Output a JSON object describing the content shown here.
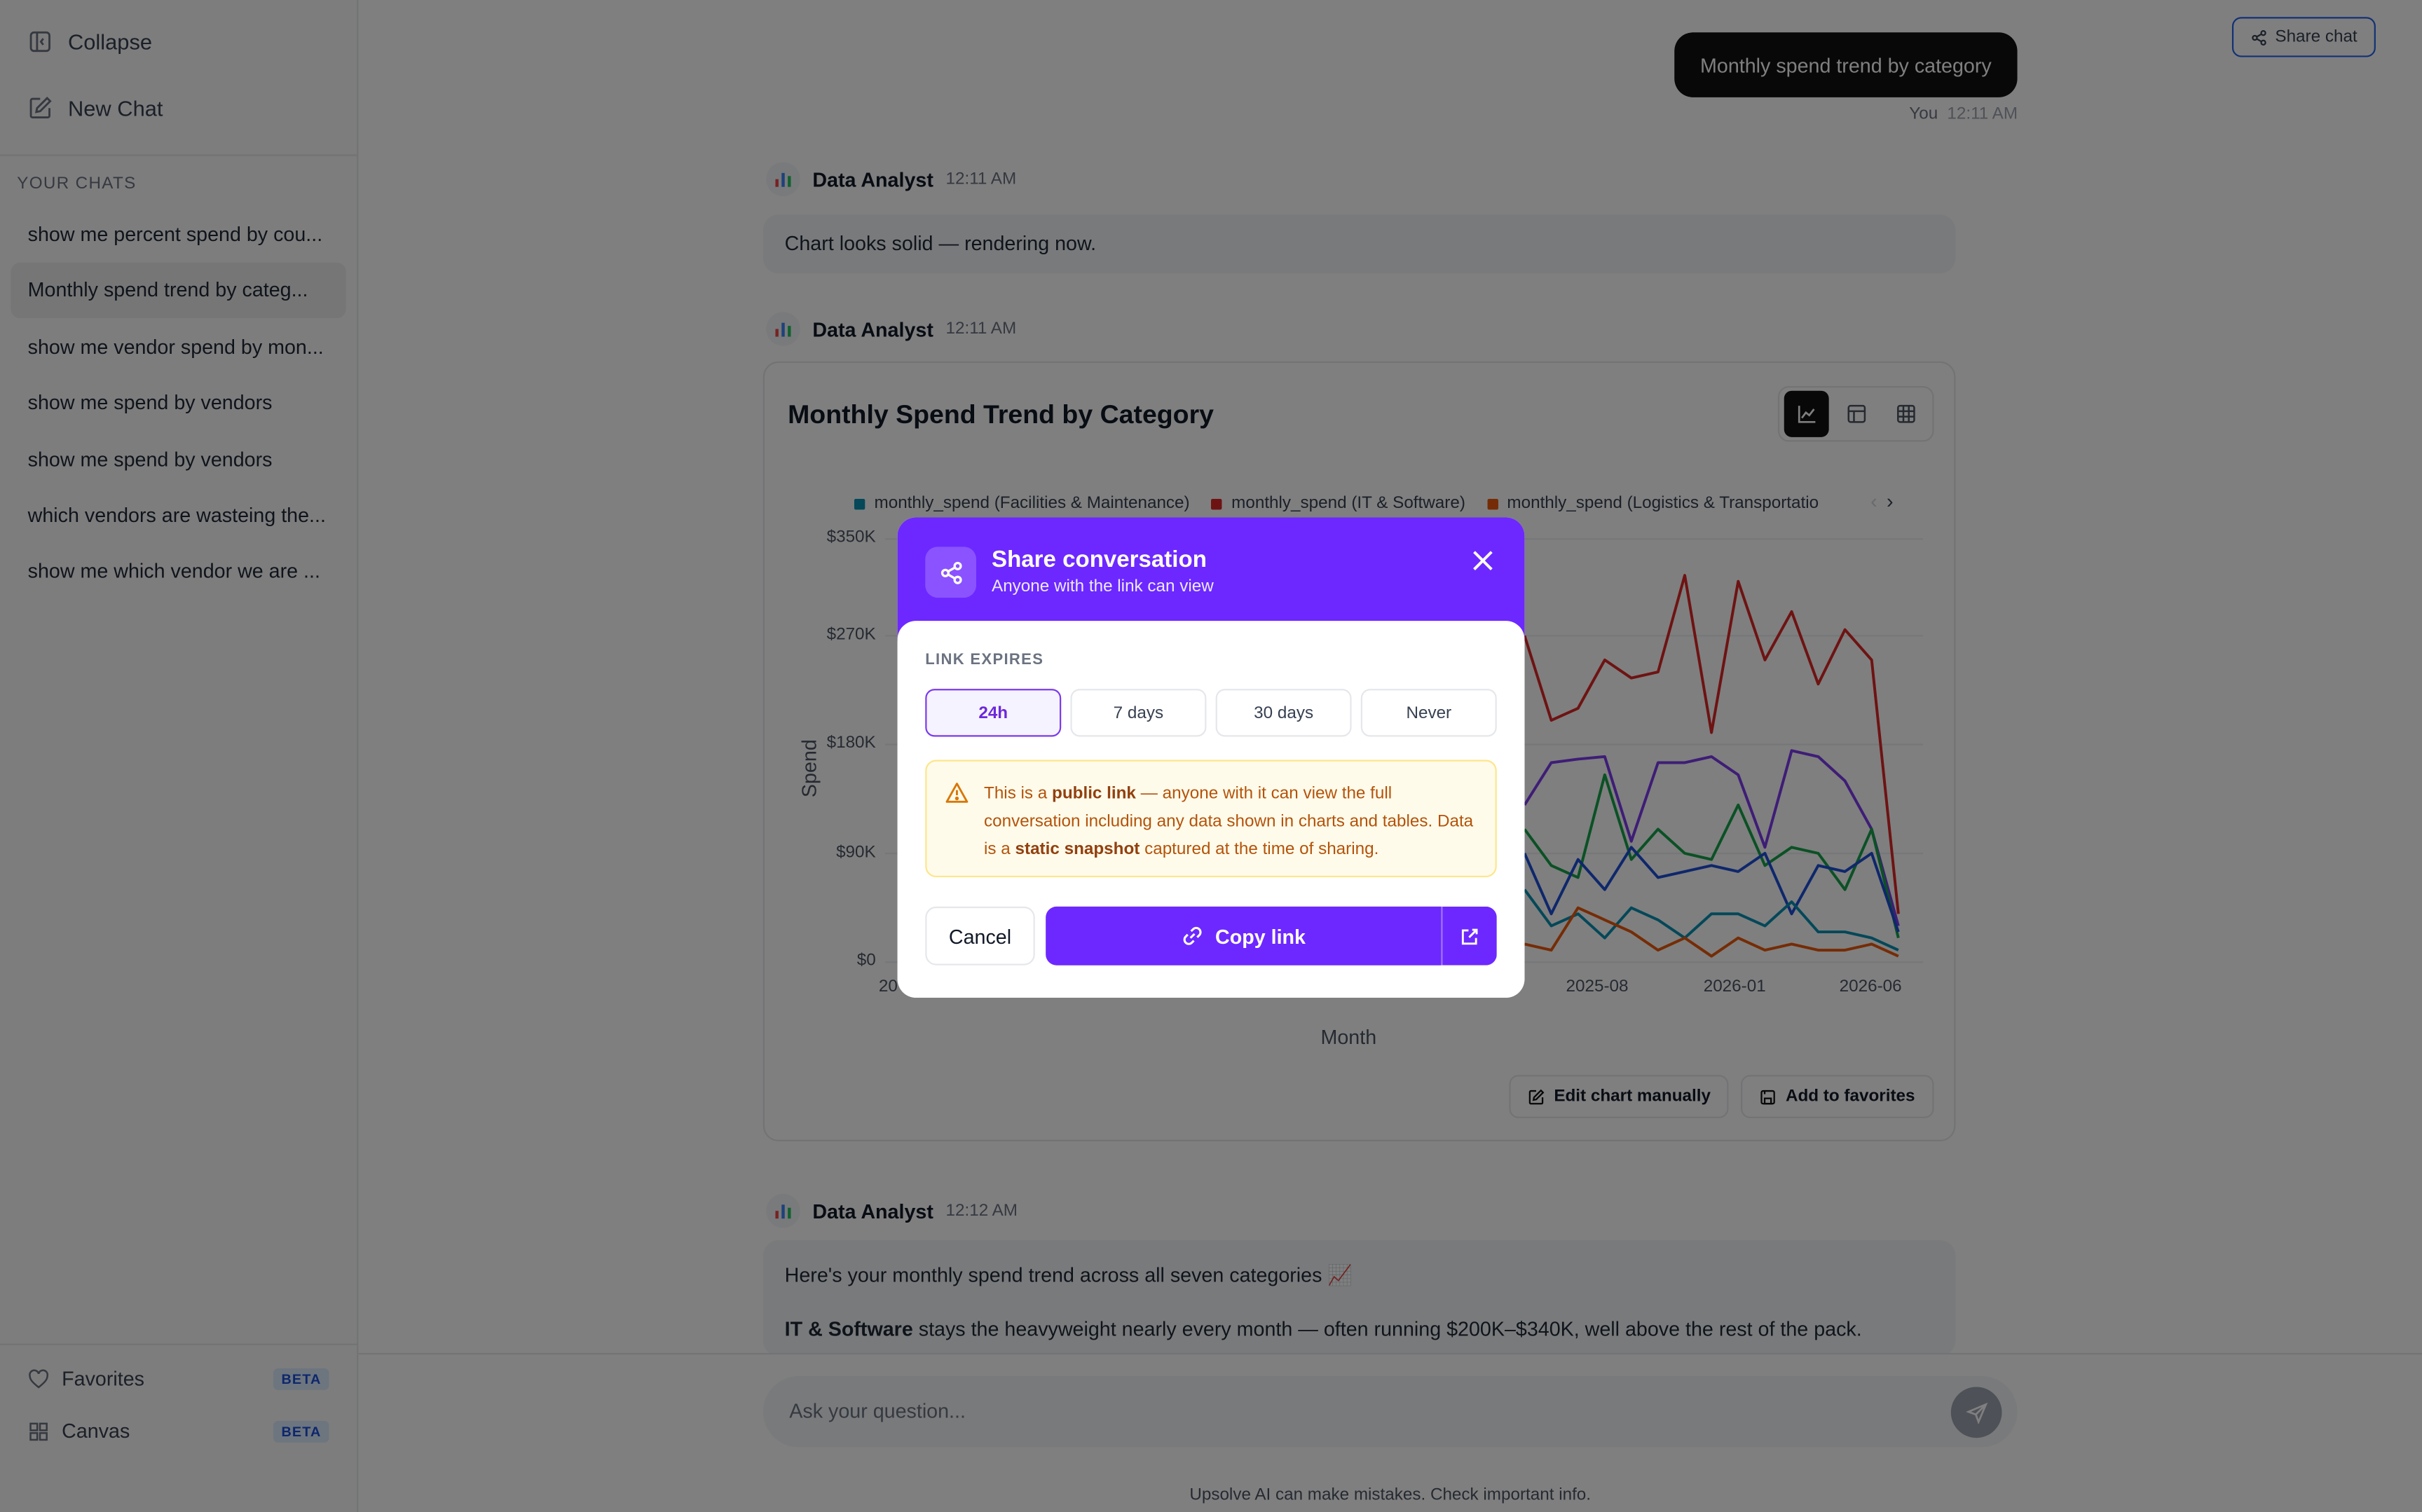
{
  "sidebar": {
    "collapse_label": "Collapse",
    "new_chat_label": "New Chat",
    "heading": "YOUR CHATS",
    "chats": [
      {
        "label": "show me percent spend by cou...",
        "active": false
      },
      {
        "label": "Monthly spend trend by categ...",
        "active": true
      },
      {
        "label": "show me vendor spend by mon...",
        "active": false
      },
      {
        "label": "show me spend by vendors",
        "active": false
      },
      {
        "label": "show me spend by vendors",
        "active": false
      },
      {
        "label": "which vendors are wasteing the...",
        "active": false
      },
      {
        "label": "show me which vendor we are ...",
        "active": false
      }
    ],
    "favorites_label": "Favorites",
    "canvas_label": "Canvas",
    "beta_label": "BETA"
  },
  "header": {
    "share_chat_label": "Share chat"
  },
  "conversation": {
    "user_message": "Monthly spend trend by category",
    "user_name": "You",
    "user_time": "12:11 AM",
    "assistant_name": "Data Analyst",
    "msg1_time": "12:11 AM",
    "msg1_text": "Chart looks solid — rendering now.",
    "msg2_time": "12:11 AM",
    "msg3_time": "12:12 AM",
    "msg3_line1": "Here's your monthly spend trend across all seven categories 📈",
    "msg3_bold": "IT & Software",
    "msg3_line2": " stays the heavyweight nearly every month — often running $200K–$340K, well above the rest of the pack."
  },
  "chart_card": {
    "edit_label": "Edit chart manually",
    "favorites_label": "Add to favorites"
  },
  "chart_data": {
    "type": "line",
    "title": "Monthly Spend Trend by Category",
    "xlabel": "Month",
    "ylabel": "Spend",
    "y_ticks": [
      "$0",
      "$90K",
      "$180K",
      "$270K",
      "$350K"
    ],
    "ylim": [
      0,
      350000
    ],
    "x_ticks_visible": [
      "20",
      "2025-08",
      "2026-01",
      "2026-06"
    ],
    "legend": [
      "monthly_spend (Facilities & Maintenance)",
      "monthly_spend (IT & Software)",
      "monthly_spend (Logistics & Transportatio"
    ],
    "grid": true,
    "series": [
      {
        "name": "monthly_spend (IT & Software)",
        "color": "#dc2626",
        "x": [
          "2025-05",
          "2025-06",
          "2025-07",
          "2025-08",
          "2025-09",
          "2025-10",
          "2025-11",
          "2025-12",
          "2026-01",
          "2026-02",
          "2026-03",
          "2026-04",
          "2026-05",
          "2026-06",
          "2026-07"
        ],
        "values": [
          270000,
          200000,
          210000,
          250000,
          235000,
          240000,
          320000,
          190000,
          315000,
          250000,
          290000,
          230000,
          275000,
          250000,
          40000
        ]
      },
      {
        "name": "",
        "color": "#7c3aed",
        "x": [
          "2025-05",
          "2025-06",
          "2025-07",
          "2025-08",
          "2025-09",
          "2025-10",
          "2025-11",
          "2025-12",
          "2026-01",
          "2026-02",
          "2026-03",
          "2026-04",
          "2026-05",
          "2026-06",
          "2026-07"
        ],
        "values": [
          130000,
          165000,
          168000,
          170000,
          100000,
          165000,
          165000,
          170000,
          155000,
          95000,
          175000,
          170000,
          150000,
          110000,
          30000
        ]
      },
      {
        "name": "",
        "color": "#16a34a",
        "x": [
          "2025-05",
          "2025-06",
          "2025-07",
          "2025-08",
          "2025-09",
          "2025-10",
          "2025-11",
          "2025-12",
          "2026-01",
          "2026-02",
          "2026-03",
          "2026-04",
          "2026-05",
          "2026-06",
          "2026-07"
        ],
        "values": [
          110000,
          80000,
          70000,
          155000,
          85000,
          110000,
          90000,
          85000,
          130000,
          80000,
          95000,
          90000,
          60000,
          110000,
          20000
        ]
      },
      {
        "name": "",
        "color": "#1d4ed8",
        "x": [
          "2025-05",
          "2025-06",
          "2025-07",
          "2025-08",
          "2025-09",
          "2025-10",
          "2025-11",
          "2025-12",
          "2026-01",
          "2026-02",
          "2026-03",
          "2026-04",
          "2026-05",
          "2026-06",
          "2026-07"
        ],
        "values": [
          90000,
          40000,
          85000,
          60000,
          95000,
          70000,
          75000,
          80000,
          75000,
          90000,
          40000,
          80000,
          75000,
          90000,
          25000
        ]
      },
      {
        "name": "monthly_spend (Facilities & Maintenance)",
        "color": "#0891b2",
        "x": [
          "2025-05",
          "2025-06",
          "2025-07",
          "2025-08",
          "2025-09",
          "2025-10",
          "2025-11",
          "2025-12",
          "2026-01",
          "2026-02",
          "2026-03",
          "2026-04",
          "2026-05",
          "2026-06",
          "2026-07"
        ],
        "values": [
          60000,
          30000,
          40000,
          20000,
          45000,
          35000,
          20000,
          40000,
          40000,
          30000,
          50000,
          25000,
          25000,
          20000,
          10000
        ]
      },
      {
        "name": "monthly_spend (Logistics & Transportatio",
        "color": "#ea580c",
        "x": [
          "2025-05",
          "2025-06",
          "2025-07",
          "2025-08",
          "2025-09",
          "2025-10",
          "2025-11",
          "2025-12",
          "2026-01",
          "2026-02",
          "2026-03",
          "2026-04",
          "2026-05",
          "2026-06",
          "2026-07"
        ],
        "values": [
          15000,
          10000,
          45000,
          35000,
          25000,
          10000,
          20000,
          5000,
          20000,
          10000,
          15000,
          10000,
          10000,
          15000,
          5000
        ]
      }
    ]
  },
  "input": {
    "placeholder": "Ask your question..."
  },
  "footer": {
    "disclaimer": "Upsolve AI can make mistakes. Check important info."
  },
  "modal": {
    "title": "Share conversation",
    "subtitle": "Anyone with the link can view",
    "section_label": "LINK EXPIRES",
    "options": [
      "24h",
      "7 days",
      "30 days",
      "Never"
    ],
    "selected_option": "24h",
    "warning_pre": "This is a ",
    "warning_bold1": "public link",
    "warning_mid": " — anyone with it can view the full conversation including any data shown in charts and tables. Data is a ",
    "warning_bold2": "static snapshot",
    "warning_post": " captured at the time of sharing.",
    "cancel_label": "Cancel",
    "copy_label": "Copy link"
  },
  "colors": {
    "accent": "#6d28ff",
    "legend_facilities": "#0891b2",
    "legend_it": "#dc2626",
    "legend_logistics": "#ea580c"
  }
}
